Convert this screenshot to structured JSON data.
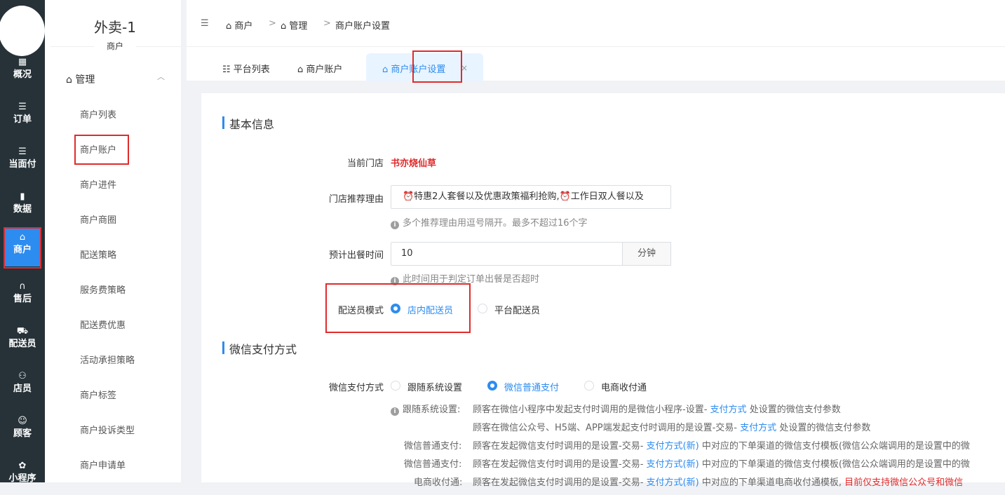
{
  "rail": {
    "items": [
      {
        "icon": "▦",
        "label": "概况"
      },
      {
        "icon": "☰",
        "label": "订单"
      },
      {
        "icon": "☰",
        "label": "当面付"
      },
      {
        "icon": "▮",
        "label": "数据"
      },
      {
        "icon": "⌂",
        "label": "商户"
      },
      {
        "icon": "∩",
        "label": "售后"
      },
      {
        "icon": "⛟",
        "label": "配送员"
      },
      {
        "icon": "⚇",
        "label": "店员"
      },
      {
        "icon": "☺",
        "label": "顾客"
      },
      {
        "icon": "✿",
        "label": "小程序"
      }
    ]
  },
  "sidebar": {
    "brand": "外卖-1",
    "brand_sub": "商户",
    "group": "管理",
    "items": [
      "商户列表",
      "商户账户",
      "商户进件",
      "商户商圈",
      "配送策略",
      "服务费策略",
      "配送费优惠",
      "活动承担策略",
      "商户标签",
      "商户投诉类型",
      "商户申请单"
    ]
  },
  "breadcrumb": {
    "collapse_icon": "☰",
    "c1": "商户",
    "c2": "管理",
    "c3": "商户账户设置",
    "sep": ">"
  },
  "tabs": {
    "t1": "平台列表",
    "t2": "商户账户",
    "t3": "商户账户设置",
    "close": "×"
  },
  "basic": {
    "title": "基本信息",
    "store_label": "当前门店",
    "store_value": "书亦烧仙草",
    "reason_label": "门店推荐理由",
    "reason_value": "⏰特惠2人套餐以及优惠政策福利抢购,⏰工作日双人餐以及",
    "reason_hint": "多个推荐理由用逗号隔开。最多不超过16个字",
    "time_label": "预计出餐时间",
    "time_value": "10",
    "time_unit": "分钟",
    "time_hint": "此时间用于判定订单出餐是否超时",
    "courier_label": "配送员模式",
    "courier_opt1": "店内配送员",
    "courier_opt2": "平台配送员"
  },
  "wechat": {
    "title": "微信支付方式",
    "label": "微信支付方式",
    "opt1": "跟随系统设置",
    "opt2": "微信普通支付",
    "opt3": "电商收付通",
    "d1_head": "跟随系统设置:",
    "d1_a": "顾客在微信小程序中发起支付时调用的是微信小程序-设置-",
    "d1_link": "支付方式",
    "d1_b": "处设置的微信支付参数",
    "d2_a": "顾客在微信公众号、H5端、APP端发起支付时调用的是设置-交易-",
    "d2_link": "支付方式",
    "d2_b": "处设置的微信支付参数",
    "d3_head": "微信普通支付:",
    "d3_a": "顾客在发起微信支付时调用的是设置-交易-",
    "d3_link": "支付方式(新)",
    "d3_b": "中对应的下单渠道的微信支付模板(微信公众端调用的是设置中的微",
    "d4_head": "微信普通支付:",
    "d4_a": "顾客在发起微信支付时调用的是设置-交易-",
    "d4_link": "支付方式(新)",
    "d4_b": "中对应的下单渠道的微信支付模板(微信公众端调用的是设置中的微",
    "d5_head": "电商收付通:",
    "d5_a": "顾客在发起微信支付时调用的是设置-交易-",
    "d5_link": "支付方式(新)",
    "d5_b": "中对应的下单渠道电商收付通模板,",
    "d5_red": "目前仅支持微信公众号和微信"
  },
  "colors": {
    "accent": "#2d8cf0",
    "rail_bg": "#263238",
    "highlight": "#e02b2b"
  }
}
